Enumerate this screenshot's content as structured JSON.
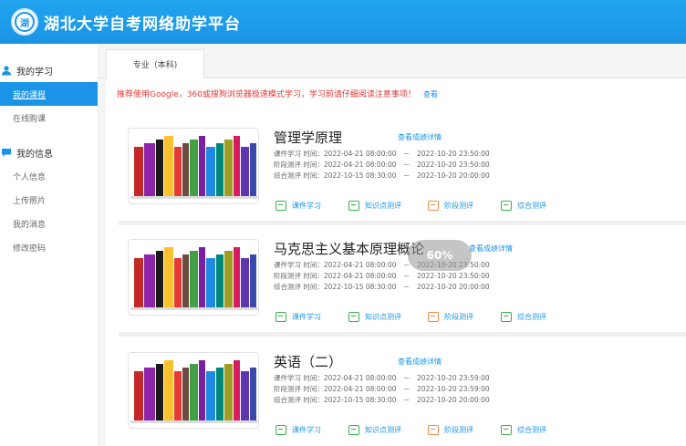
{
  "header": {
    "title": "湖北大学自考网络助学平台",
    "logo_icon": "university-seal-icon"
  },
  "sidebar": {
    "groups": [
      {
        "label": "我的学习",
        "icon": "user-icon",
        "items": [
          {
            "label": "我的课程",
            "active": true
          },
          {
            "label": "在线购课"
          }
        ]
      },
      {
        "label": "我的信息",
        "icon": "chat-icon",
        "items": [
          {
            "label": "个人信息"
          },
          {
            "label": "上传照片"
          },
          {
            "label": "我的消息"
          },
          {
            "label": "修改密码"
          }
        ]
      }
    ]
  },
  "tabs": [
    {
      "label": "专业（本科)"
    }
  ],
  "notice": {
    "text": "推荐使用Google，360或搜狗浏览器极速模式学习，学习前请仔细阅读注意事项！",
    "link": "查看"
  },
  "progress_overlay": "60%",
  "courses": [
    {
      "title": "管理学原理",
      "score_link": "查看成绩详情",
      "lines": [
        "课件学习 时间：2022-04-21 08:00:00　－　2022-10-20 23:50:00",
        "阶段测评 时间：2022-04-21 08:00:00　－　2022-10-20 23:50:00",
        "综合测评 时间：2022-10-15 08:30:00　－　2022-10-20 20:00:00"
      ],
      "actions": [
        "课件学习",
        "知识点测评",
        "阶段测评",
        "综合测评"
      ]
    },
    {
      "title": "马克思主义基本原理概论",
      "score_link": "查看成绩详情",
      "lines": [
        "课件学习 时间：2022-04-21 08:00:00　－　2022-10-20 23:50:00",
        "阶段测评 时间：2022-04-21 08:00:00　－　2022-10-20 23:50:00",
        "综合测评 时间：2022-10-15 08:30:00　－　2022-10-20 20:00:00"
      ],
      "actions": [
        "课件学习",
        "知识点测评",
        "阶段测评",
        "综合测评"
      ]
    },
    {
      "title": "英语（二）",
      "score_link": "查看成绩详情",
      "lines": [
        "课件学习 时间：2022-04-21 08:00:00　－　2022-10-20 23:59:00",
        "阶段测评 时间：2022-04-21 08:00:00　－　2022-10-20 23:59:00",
        "综合测评 时间：2022-10-15 08:30:00　－　2022-10-20 20:00:00"
      ],
      "actions": [
        "课件学习",
        "知识点测评",
        "阶段测评",
        "综合测评"
      ]
    }
  ],
  "colors": {
    "brand": "#1a94e6",
    "notice": "#e53935",
    "action_green": "#37b24d",
    "action_orange": "#f08c4a"
  }
}
